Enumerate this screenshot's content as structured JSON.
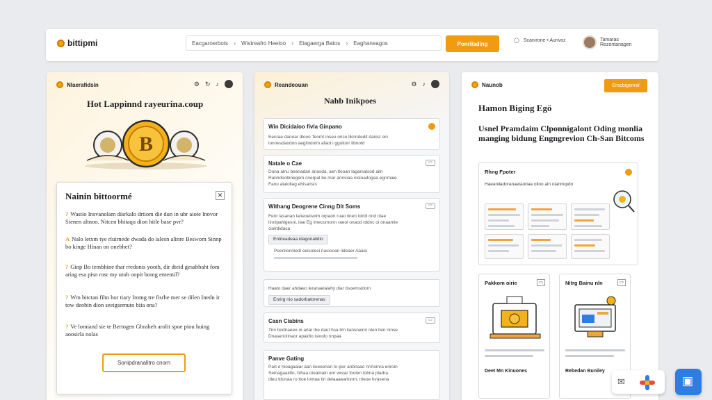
{
  "topbar": {
    "logo": "bittipmi",
    "breadcrumbs": [
      "Eacgaroerbots",
      "Wistreafro Heeloo",
      "Eiagaerga Batos",
      "Eaghaneagos"
    ],
    "primary_button": "Ponrilading",
    "user_label": "Scanirone • Aunvoz",
    "profile_name": "Tamaras",
    "profile_sub": "Rezontanagen"
  },
  "column1": {
    "header": "Nlaerafidsin",
    "title": "Hot Lappinnd rayeurina.coup",
    "modal": {
      "title": "Nainin bittoormé",
      "questions": [
        {
          "marker": "?",
          "text": "Wastio Insvanolam disrkalo drtiom die dun in ubr aiote lnovor Sienen altnoo. Nitcen bhitaqu dion hitle base pvr?"
        },
        {
          "marker": "A",
          "text": "Nalo letxm tye rluirnede dwada do ialesn alinre Beswom Sinnp bo kinge Hinan on onebhet?"
        },
        {
          "marker": "?",
          "text": "Ginp Bo tembhine thar rredonis yooth, dir dteid gesabbaht fom ariag esa pisn rosr my utoh oopit bomg entemil?"
        },
        {
          "marker": "?",
          "text": "Wm bitctan fihn hor tiary Irotng tre fisrhe mer se dilen Inedn ir tow deobin dion seeigsemuto biia ona?"
        },
        {
          "marker": "?",
          "text": "Ve lomiand sie te Bertogen Ghrabeh arolit spoe piou huing aoosirla nolas"
        }
      ],
      "button": "Sonipdranalitro cnorn"
    }
  },
  "column2": {
    "header": "Reandeouan",
    "title": "Nahb Inikpoes",
    "cards": [
      {
        "title": "Win Dicidaloo fivla Ginpano",
        "lines": [
          "Eenrae danoar dlooo Teomt inseo oriso liknndedit daiosl oin",
          "lonnesdaodon aegiindolm afaot i ggoitorr libnotd"
        ]
      },
      {
        "title": "Natale o Cae",
        "lines": [
          "Dona alnu beanadan anasda, aen tlooan lagarsalsod ailn",
          "Ranndoobinegem cnerpal bo mar annsiaa nisloadogaa egnmaie",
          "Fanu ataloliag ehisansis"
        ]
      },
      {
        "title": "Withang Deogrene Cinng Dit Soms",
        "lines": [
          "Fenr lasanan laneoeisolm orpaon ruao linen loirdi nnd nlae",
          "linnlpahlgesni, iiae Eg lmecomonn raeol onaod rddnc oi onaamie",
          "ciolrdidaca"
        ],
        "chip": "Entrieadeaa idagonalidlo",
        "chip_line": "Peenlionniedi eeisolesi nasiooan iideaer Aaala"
      },
      {
        "title": "",
        "lines": [
          "Haato daer ahdaeo leranaeiaiahy diar tisoemsidorn"
        ],
        "chip": "Enrirg nio sadorbatorenas"
      },
      {
        "title": "Casn Ciabins",
        "lines": [
          "Tirn bodiraeeo oi arlar ihe daut hsa lirn liansneinn olen tien ninse",
          "Dnasenolinaor apaidio isioolo nnpaa"
        ]
      },
      {
        "title": "Panve Gating",
        "lines": [
          "Part e hioagaaiar aan lioeeenan lo ipsr anbiraao nr/rioinra eriroin",
          "Seinagaaidlo, hihaa oioamain anr wrear foolen tobna pladra",
          "dieu tdonaa ro ttoe lomaa tin delaaaearlonm, nteoe hvasena"
        ]
      }
    ]
  },
  "column3": {
    "header": "Naunob",
    "button": "Eracbigenral",
    "headline": "Hamon Biging Egö",
    "subheadline": "Usnel Pramdaim Clponnigalont Oding monlia manging bidung Engngrevion Ch-San Bitcoms",
    "dashboard": {
      "title": "Rhng Fpoter",
      "subtitle": "Haeaniladoranaeiaoriaa olloo ain oianriopdo"
    },
    "tiles": [
      {
        "title": "Pakkom oirie",
        "footer": "Deet Mn Kinuones"
      },
      {
        "title": "Nitrg Bainu nln",
        "footer": "Rebedan Buniley"
      }
    ]
  },
  "colors": {
    "accent": "#f09b12",
    "background": "#e9ebee",
    "blue": "#2f7de1"
  }
}
